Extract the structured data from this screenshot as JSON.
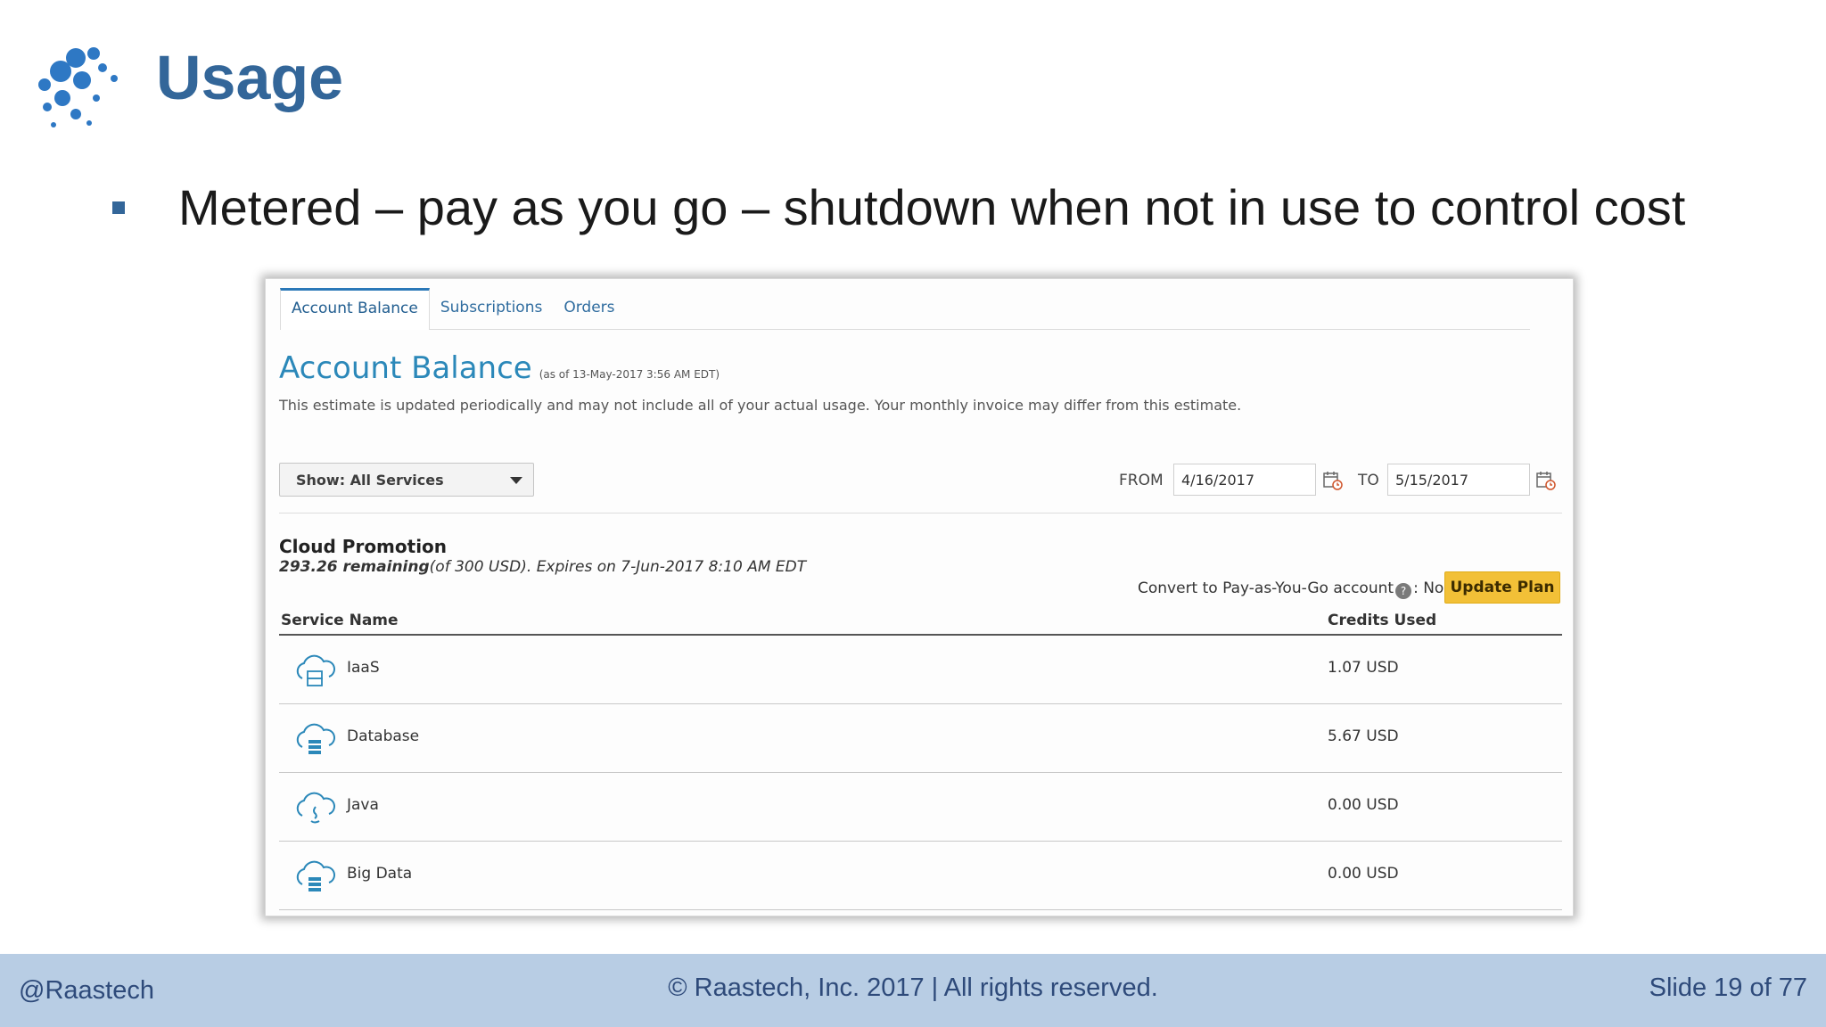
{
  "slide": {
    "title": "Usage",
    "bullet": "Metered – pay as you go – shutdown when not in use to control cost"
  },
  "ui": {
    "tabs": [
      {
        "label": "Account Balance",
        "active": true
      },
      {
        "label": "Subscriptions",
        "active": false
      },
      {
        "label": "Orders",
        "active": false
      }
    ],
    "page_title": "Account Balance",
    "as_of": "(as of 13-May-2017 3:56 AM EDT)",
    "estimate_note": "This estimate is updated periodically and may not include all of your actual usage. Your monthly invoice may differ from this estimate.",
    "show_dropdown": "Show: All Services",
    "from_label": "FROM",
    "from_value": "4/16/2017",
    "to_label": "TO",
    "to_value": "5/15/2017",
    "promo_title": "Cloud Promotion",
    "promo_remaining": "293.26 remaining",
    "promo_rest": "(of 300 USD). Expires on 7-Jun-2017 8:10 AM EDT",
    "convert_label": "Convert to Pay-as-You-Go account",
    "help_glyph": "?",
    "convert_value": ": No",
    "update_button": "Update Plan",
    "columns": {
      "service": "Service Name",
      "credits": "Credits Used"
    },
    "services": [
      {
        "name": "IaaS",
        "credits": "1.07 USD",
        "icon": "cloud-server-icon"
      },
      {
        "name": "Database",
        "credits": "5.67 USD",
        "icon": "cloud-database-icon"
      },
      {
        "name": "Java",
        "credits": "0.00 USD",
        "icon": "cloud-java-icon"
      },
      {
        "name": "Big Data",
        "credits": "0.00 USD",
        "icon": "cloud-bigdata-icon"
      }
    ],
    "colors": {
      "accent": "#2b88b9",
      "button": "#f2c037",
      "slide_title": "#336699",
      "footer_bg": "#b8cde4"
    }
  },
  "footer": {
    "left": "@Raastech",
    "center": "© Raastech, Inc. 2017  |  All rights reserved.",
    "right": "Slide 19 of 77"
  }
}
